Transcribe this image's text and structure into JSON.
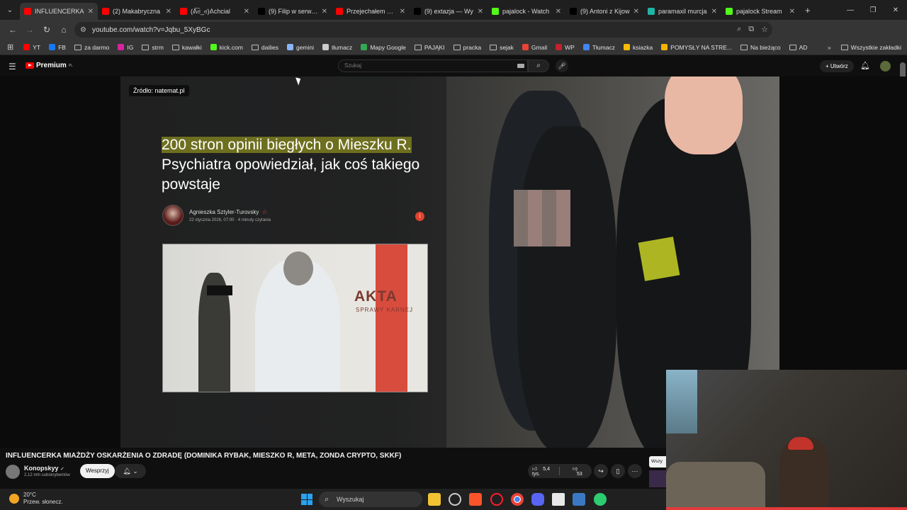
{
  "browser": {
    "tabs": [
      {
        "label": "INFLUENCERKA",
        "active": true,
        "color": "#ff0000"
      },
      {
        "label": "(2) Makabryczna",
        "color": "#ff0000"
      },
      {
        "label": "(ᕕ͡ಠ_ಠ)ᕕchcial",
        "color": "#ff0000"
      },
      {
        "label": "(9) Filip w serwisie",
        "color": "#000000"
      },
      {
        "label": "Przejechałem Pol",
        "color": "#ff0000"
      },
      {
        "label": "(9) extazja — Wy",
        "color": "#000000"
      },
      {
        "label": "pajalock - Watch",
        "color": "#53fc18"
      },
      {
        "label": "(9) Antoni z Kijow",
        "color": "#000000"
      },
      {
        "label": "paramaxil murcja",
        "color": "#1fb4a8"
      },
      {
        "label": "pajalock Stream",
        "color": "#53fc18"
      }
    ],
    "url": "youtube.com/watch?v=Jqbu_5XyBGc",
    "bookmarks": [
      {
        "label": "YT",
        "icon": "youtube-icon",
        "color": "#ff0000"
      },
      {
        "label": "FB",
        "icon": "facebook-icon",
        "color": "#1877f2"
      },
      {
        "label": "za darmo",
        "icon": "folder-icon"
      },
      {
        "label": "IG",
        "icon": "instagram-icon",
        "color": "#d6249f"
      },
      {
        "label": "strm",
        "icon": "folder-icon"
      },
      {
        "label": "kawałki",
        "icon": "folder-icon"
      },
      {
        "label": "kick.com",
        "icon": "kick-icon",
        "color": "#53fc18"
      },
      {
        "label": "dailies",
        "icon": "folder-icon"
      },
      {
        "label": "gemini",
        "icon": "gemini-icon",
        "color": "#8ab4f8"
      },
      {
        "label": "tłumacz",
        "icon": "translate-icon",
        "color": "#cccccc"
      },
      {
        "label": "Mapy Google",
        "icon": "maps-icon",
        "color": "#34a853"
      },
      {
        "label": "PAJĄKI",
        "icon": "folder-icon"
      },
      {
        "label": "pracka",
        "icon": "folder-icon"
      },
      {
        "label": "sejak",
        "icon": "folder-icon"
      },
      {
        "label": "Gmail",
        "icon": "gmail-icon",
        "color": "#ea4335"
      },
      {
        "label": "WP",
        "icon": "wp-icon",
        "color": "#c2222b"
      },
      {
        "label": "Tłumacz",
        "icon": "translate-icon",
        "color": "#4285f4"
      },
      {
        "label": "ksiazka",
        "icon": "book-icon",
        "color": "#fbbc05"
      },
      {
        "label": "POMYSŁY NA STRE...",
        "icon": "ideas-icon",
        "color": "#f4b400"
      },
      {
        "label": "Na bieżąco",
        "icon": "folder-icon"
      },
      {
        "label": "AD",
        "icon": "folder-icon"
      }
    ],
    "all_bookmarks": "Wszystkie zakładki"
  },
  "youtube": {
    "logo_text": "Premium",
    "logo_sup": "PL",
    "search_placeholder": "Szukaj",
    "create_label": "Utwórz",
    "video_title": "INFLUENCERKA MIAŻDŻY OSKARŻENIA O ZDRADĘ (DOMINIKA RYBAK, MIESZKO R, META, ZONDA CRYPTO, SKKF)",
    "channel_name": "Konopskyy",
    "channel_subs": "2,12 mln subskrybentów",
    "support_label": "Wesprzyj",
    "likes": "5,4 tys.",
    "dislikes": "53",
    "overflow_label": "Wszy"
  },
  "video": {
    "source": "Źródło: natemat.pl",
    "headline_highlight": "200 stron opinii biegłych o Mieszku R.",
    "headline_rest": "Psychiatra opowiedział, jak coś takiego powstaje",
    "author": "Agnieszka Sztyler-Turovsky",
    "meta": "22 stycznia 2026, 07:00 · 4 minuty czytania",
    "image_sign": "AKTA",
    "image_sign_sub": "SPRAWY KARNEJ"
  },
  "taskbar": {
    "temp": "20°C",
    "weather": "Przew. słonecz.",
    "search": "Wyszukaj"
  }
}
